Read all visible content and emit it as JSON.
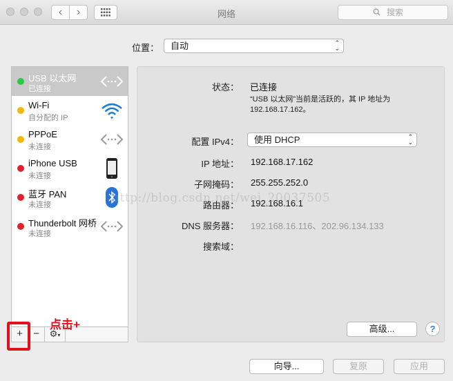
{
  "window": {
    "title": "网络",
    "search_placeholder": "搜索"
  },
  "location": {
    "label": "位置：",
    "value": "自动"
  },
  "services": [
    {
      "name": "USB 以太网",
      "status": "已连接",
      "dot": "#28c840",
      "icon": "ethernet-icon",
      "selected": true
    },
    {
      "name": "Wi-Fi",
      "status": "自分配的 IP",
      "dot": "#f5b800",
      "icon": "wifi-icon"
    },
    {
      "name": "PPPoE",
      "status": "未连接",
      "dot": "#f5b800",
      "icon": "ethernet-icon"
    },
    {
      "name": "iPhone USB",
      "status": "未连接",
      "dot": "#e5202e",
      "icon": "iphone-icon"
    },
    {
      "name": "蓝牙 PAN",
      "status": "未连接",
      "dot": "#e5202e",
      "icon": "bluetooth-icon"
    },
    {
      "name": "Thunderbolt 网桥",
      "status": "未连接",
      "dot": "#e5202e",
      "icon": "ethernet-icon"
    }
  ],
  "sidebar_toolbar": {
    "add": "+",
    "remove": "−",
    "action": "⚙"
  },
  "annotation": "点击+",
  "detail": {
    "status_label": "状态：",
    "status_value": "已连接",
    "status_note": "“USB 以太网”当前是活跃的，其 IP 地址为 192.168.17.162。",
    "config_label": "配置 IPv4：",
    "config_value": "使用 DHCP",
    "ip_label": "IP 地址：",
    "ip_value": "192.168.17.162",
    "subnet_label": "子网掩码：",
    "subnet_value": "255.255.252.0",
    "router_label": "路由器：",
    "router_value": "192.168.16.1",
    "dns_label": "DNS 服务器：",
    "dns_value": "192.168.16.116、202.96.134.133",
    "search_domain_label": "搜索域："
  },
  "buttons": {
    "advanced": "高级...",
    "help": "?",
    "assistant": "向导...",
    "revert": "复原",
    "apply": "应用"
  },
  "watermark": "http://blog.csdn.net/wei_20037505"
}
